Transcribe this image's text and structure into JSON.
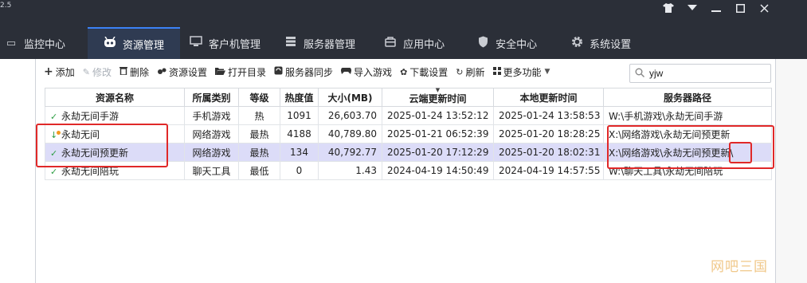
{
  "app": {
    "version": "2.5"
  },
  "window_controls": [
    "shirt-icon",
    "menu-icon",
    "minimize-icon",
    "maximize-icon",
    "close-icon"
  ],
  "nav": {
    "items": [
      {
        "label": "监控中心",
        "icon": "monitor-icon"
      },
      {
        "label": "资源管理",
        "icon": "resource-icon",
        "active": true
      },
      {
        "label": "客户机管理",
        "icon": "client-icon"
      },
      {
        "label": "服务器管理",
        "icon": "server-icon"
      },
      {
        "label": "应用中心",
        "icon": "app-icon"
      },
      {
        "label": "安全中心",
        "icon": "shield-icon"
      },
      {
        "label": "系统设置",
        "icon": "gear-icon"
      }
    ]
  },
  "toolbar": {
    "add": "添加",
    "edit": "修改",
    "delete": "删除",
    "resource_settings": "资源设置",
    "open_dir": "打开目录",
    "server_sync": "服务器同步",
    "import_games": "导入游戏",
    "download_settings": "下載设置",
    "refresh": "刷新",
    "more": "更多功能"
  },
  "search": {
    "value": "yjw"
  },
  "table": {
    "columns": [
      "资源名称",
      "所属类别",
      "等级",
      "热度值",
      "大小(MB)",
      "云端更新时间",
      "本地更新时间",
      "服务器路径"
    ],
    "rows": [
      {
        "status": "ok",
        "name": "永劫无间手游",
        "category": "手机游戏",
        "level": "热",
        "heat": "1091",
        "size": "26,603.70",
        "cloud_time": "2025-01-24 13:52:12",
        "local_time": "2025-01-24 13:58:53",
        "path": "W:\\手机游戏\\永劫无间手游"
      },
      {
        "status": "downloading",
        "name": "永劫无间",
        "category": "网络游戏",
        "level": "最热",
        "heat": "4188",
        "size": "40,789.80",
        "cloud_time": "2025-01-21 06:52:39",
        "local_time": "2025-01-20 18:28:25",
        "path": "X:\\网络游戏\\永劫无间预更新"
      },
      {
        "status": "ok",
        "name": "永劫无间预更新",
        "category": "网络游戏",
        "level": "最热",
        "heat": "134",
        "size": "40,792.77",
        "cloud_time": "2025-01-20 17:12:29",
        "local_time": "2025-01-20 18:02:31",
        "path": "X:\\网络游戏\\永劫无间预更新\\",
        "selected": true
      },
      {
        "status": "ok",
        "name": "永劫无间陪玩",
        "category": "聊天工具",
        "level": "最低",
        "heat": "0",
        "size": "1.43",
        "cloud_time": "2024-04-19 14:50:49",
        "local_time": "2024-04-19 14:57:55",
        "path": "W:\\聊天工具\\永劫无间陪玩"
      }
    ]
  },
  "colors": {
    "topbar": "#2b2f38",
    "nav_active": "#2f3b52",
    "selected_row": "#dcdcf8",
    "annotation": "#e02828",
    "ok": "#2e9e44"
  },
  "watermark": "网吧三国"
}
